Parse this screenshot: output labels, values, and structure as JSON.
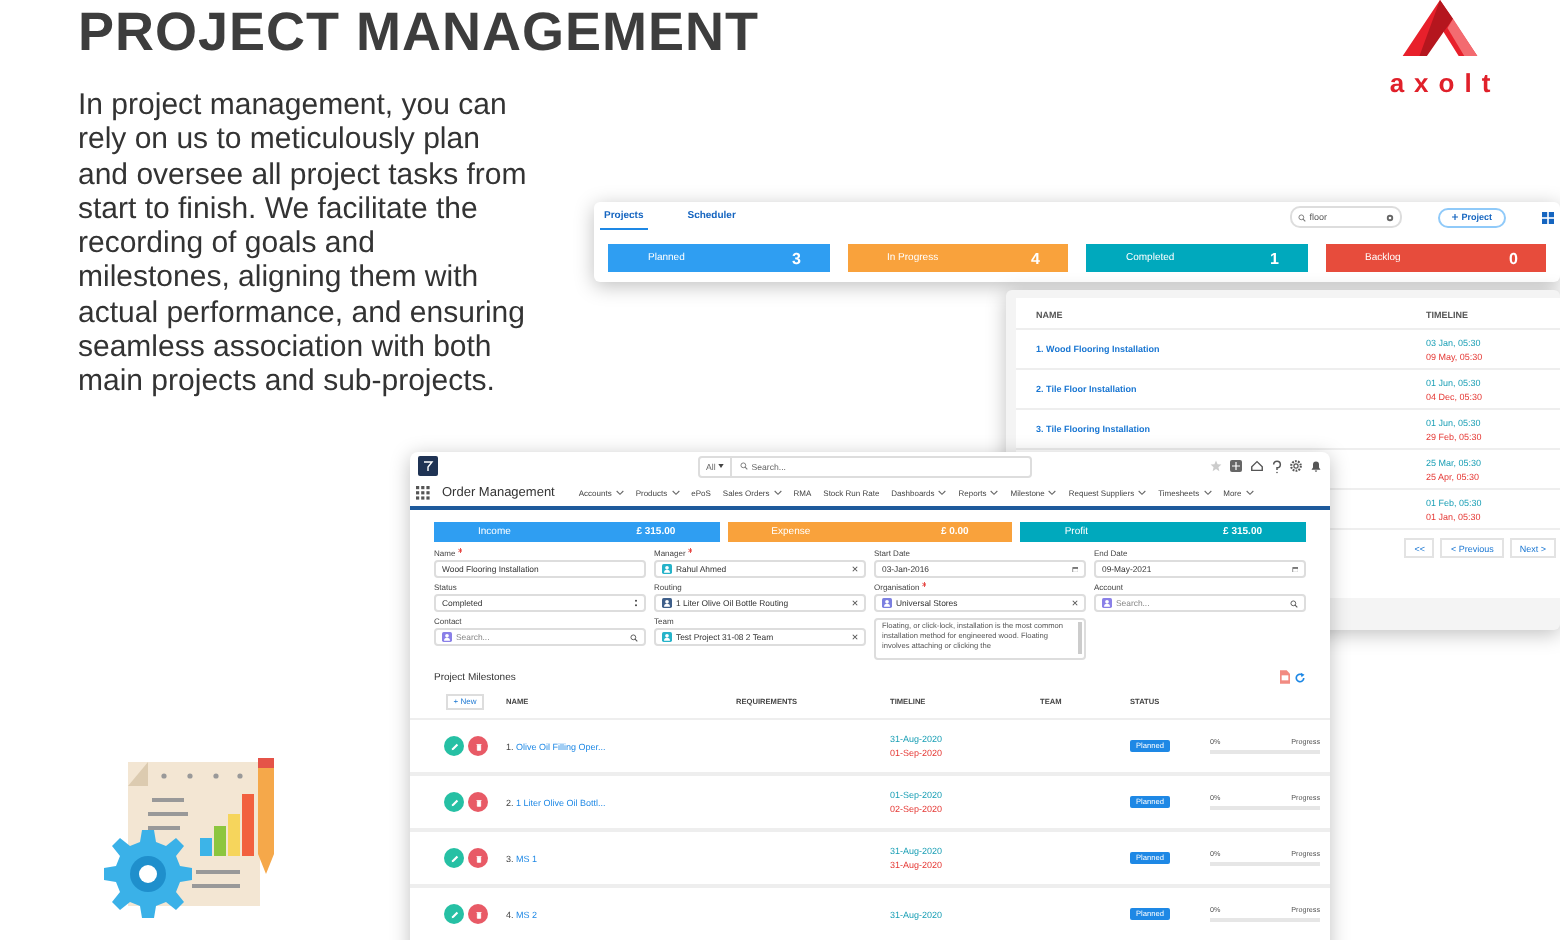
{
  "headline": {
    "title": "PROJECT MANAGEMENT",
    "body": "In project management, you can rely on us to meticulously plan and oversee all project tasks from start to finish. We facilitate the recording of goals and milestones, aligning them with actual performance, and ensuring seamless association with both main projects and sub-projects."
  },
  "logo": {
    "text": "axolt"
  },
  "board_window": {
    "tabs": [
      {
        "label": "Projects",
        "selected": true
      },
      {
        "label": "Scheduler",
        "selected": false
      }
    ],
    "search": {
      "value": "floor"
    },
    "add_button": "Project",
    "status_cards": [
      {
        "label": "Planned",
        "count": "3",
        "color": "#2f9ef2"
      },
      {
        "label": "In Progress",
        "count": "4",
        "color": "#f9a23c"
      },
      {
        "label": "Completed",
        "count": "1",
        "color": "#00a9bd"
      },
      {
        "label": "Backlog",
        "count": "0",
        "color": "#e74c3c"
      }
    ]
  },
  "projects_window": {
    "columns": [
      "NAME",
      "TIMELINE"
    ],
    "rows": [
      {
        "num": "1.",
        "name": "Wood Flooring Installation",
        "start": "03 Jan, 05:30",
        "end": "09 May, 05:30"
      },
      {
        "num": "2.",
        "name": "Tile Floor Installation",
        "start": "01 Jun, 05:30",
        "end": "04 Dec, 05:30"
      },
      {
        "num": "3.",
        "name": "Tile Flooring Installation",
        "start": "01 Jun, 05:30",
        "end": "29 Feb, 05:30"
      },
      {
        "start": "25 Mar, 05:30",
        "end": "25 Apr, 05:30"
      },
      {
        "start": "01 Feb, 05:30",
        "end": "01 Jan, 05:30"
      }
    ],
    "pagination": [
      "<<",
      "< Previous",
      "Next >"
    ]
  },
  "app_window": {
    "search": {
      "scope": "All",
      "placeholder": "Search..."
    },
    "app_name": "Order Management",
    "nav": [
      {
        "label": "Accounts",
        "menu": true
      },
      {
        "label": "Products",
        "menu": true
      },
      {
        "label": "ePoS",
        "menu": false
      },
      {
        "label": "Sales Orders",
        "menu": true
      },
      {
        "label": "RMA",
        "menu": false
      },
      {
        "label": "Stock Run Rate",
        "menu": false
      },
      {
        "label": "Dashboards",
        "menu": true
      },
      {
        "label": "Reports",
        "menu": true
      },
      {
        "label": "Milestone",
        "menu": true
      },
      {
        "label": "Request Suppliers",
        "menu": true
      },
      {
        "label": "Timesheets",
        "menu": true
      },
      {
        "label": "More",
        "menu": true
      }
    ],
    "totals": [
      {
        "label": "Income",
        "value": "£ 315.00",
        "color": "#2f9ef2"
      },
      {
        "label": "Expense",
        "value": "£ 0.00",
        "color": "#f9a23c"
      },
      {
        "label": "Profit",
        "value": "£ 315.00",
        "color": "#00a9bd"
      }
    ],
    "fields": [
      {
        "kind": "text",
        "label": "Name",
        "required": true,
        "value": "Wood Flooring Installation"
      },
      {
        "kind": "user",
        "label": "Manager",
        "required": true,
        "value": "Rahul Ahmed"
      },
      {
        "kind": "date",
        "label": "Start Date",
        "required": false,
        "value": "03-Jan-2016"
      },
      {
        "kind": "date",
        "label": "End Date",
        "required": false,
        "value": "09-May-2021"
      },
      {
        "kind": "select",
        "label": "Status",
        "required": false,
        "value": "Completed"
      },
      {
        "kind": "routing",
        "label": "Routing",
        "required": false,
        "value": "1 Liter Olive Oil Bottle Routing"
      },
      {
        "kind": "org",
        "label": "Organisation",
        "required": true,
        "value": "Universal Stores"
      },
      {
        "kind": "search",
        "label": "Account",
        "required": false,
        "placeholder": "Search..."
      },
      {
        "kind": "search",
        "label": "Contact",
        "required": false,
        "placeholder": "Search..."
      },
      {
        "kind": "user",
        "label": "Team",
        "required": false,
        "value": "Test Project 31-08 2 Team"
      },
      {
        "kind": "textarea",
        "required": false,
        "value": "Floating, or click-lock, installation is the most common installation method for engineered wood. Floating involves attaching or clicking the"
      }
    ],
    "milestones": {
      "title": "Project Milestones",
      "new_button": "+ New",
      "columns": [
        "NAME",
        "REQUIREMENTS",
        "TIMELINE",
        "TEAM",
        "STATUS"
      ],
      "rows": [
        {
          "num": "1.",
          "name": "Olive Oil Filling Oper...",
          "start": "31-Aug-2020",
          "end": "01-Sep-2020",
          "status": "Planned",
          "percent": "0%",
          "progress_label": "Progress",
          "level": 0
        },
        {
          "num": "2.",
          "name": "1 Liter Olive Oil Bottl...",
          "start": "01-Sep-2020",
          "end": "02-Sep-2020",
          "status": "Planned",
          "percent": "0%",
          "progress_label": "Progress",
          "level": 0
        },
        {
          "num": "3.",
          "name": "MS 1",
          "start": "31-Aug-2020",
          "end": "31-Aug-2020",
          "status": "Planned",
          "percent": "0%",
          "progress_label": "Progress",
          "level": 0
        },
        {
          "num": "4.",
          "name": "MS 2",
          "start": "31-Aug-2020",
          "status": "Planned",
          "percent": "0%",
          "progress_label": "Progress",
          "level": 0
        }
      ]
    }
  }
}
